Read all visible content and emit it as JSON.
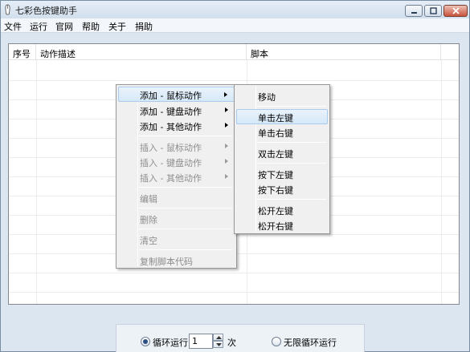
{
  "window": {
    "title": "七彩色按键助手"
  },
  "menubar": {
    "items": [
      "文件",
      "运行",
      "官网",
      "帮助",
      "关于",
      "捐助"
    ]
  },
  "table": {
    "columns": [
      "序号",
      "动作描述",
      "脚本"
    ]
  },
  "context_menu": {
    "items": [
      {
        "label": "添加 - 鼠标动作",
        "disabled": false,
        "submenu": true,
        "highlighted": true
      },
      {
        "label": "添加 - 键盘动作",
        "disabled": false,
        "submenu": true
      },
      {
        "label": "添加 - 其他动作",
        "disabled": false,
        "submenu": true
      },
      {
        "label": "插入 - 鼠标动作",
        "disabled": true,
        "submenu": true
      },
      {
        "label": "插入 - 键盘动作",
        "disabled": true,
        "submenu": true
      },
      {
        "label": "插入 - 其他动作",
        "disabled": true,
        "submenu": true
      },
      {
        "label": "编辑",
        "disabled": true
      },
      {
        "label": "删除",
        "disabled": true
      },
      {
        "label": "清空",
        "disabled": true
      },
      {
        "label": "复制脚本代码",
        "disabled": true
      }
    ]
  },
  "submenu": {
    "items": [
      "移动",
      "单击左键",
      "单击右键",
      "双击左键",
      "按下左键",
      "按下右键",
      "松开左键",
      "松开右键"
    ],
    "highlighted": "单击左键"
  },
  "run_options": {
    "loop_label": "循环运行",
    "loop_count": "1",
    "times_unit": "次",
    "infinite_label": "无限循环运行",
    "selected": "loop"
  }
}
